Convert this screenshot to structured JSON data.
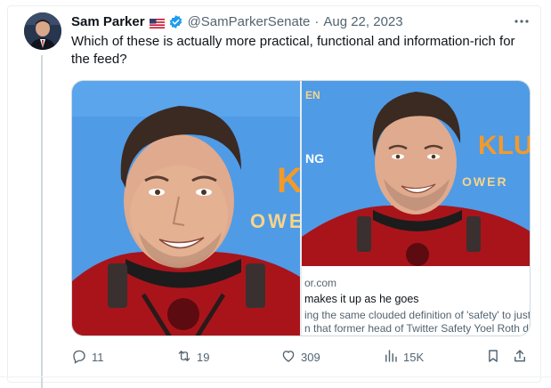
{
  "tweet": {
    "author_name": "Sam Parker",
    "handle": "@SamParkerSenate",
    "separator": "·",
    "date": "Aug 22, 2023",
    "text": "Which of these is actually more practical, functional and information-rich for the feed?",
    "flag_icon": "us-flag-icon",
    "verified_icon": "verified-badge-icon",
    "more_icon": "more-options-icon"
  },
  "link_card": {
    "domain": "or.com",
    "title": "makes it up as he goes",
    "description_line1": "ing the same clouded definition of 'safety' to justi",
    "description_line2": "n that former head of Twitter Safety Yoel Roth did"
  },
  "image_overlay_text": {
    "left_word": "KLU",
    "left_word2": "OWE",
    "right_word": "KLU",
    "right_word2": "OWER",
    "right_partial": "NG",
    "right_partial2": "EN"
  },
  "actions": {
    "replies": "11",
    "reposts": "19",
    "likes": "309",
    "views": "15K"
  },
  "colors": {
    "accent": "#1d9bf0",
    "secondary_text": "#536471",
    "background_blue": "#4d9ae6",
    "costume_red": "#b0141c",
    "sign_orange": "#f29a2b"
  }
}
